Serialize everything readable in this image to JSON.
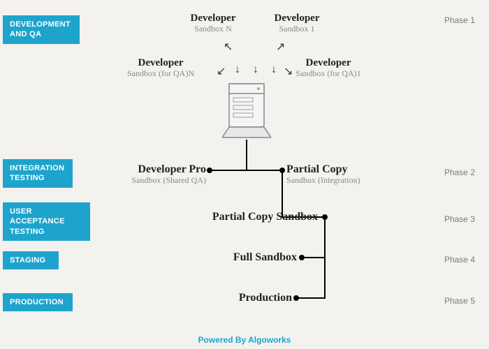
{
  "tags": {
    "dev_qa": "DEVELOPMENT\nAND QA",
    "integration": "INTEGRATION\nTESTING",
    "uat": "USER ACCEPTANCE\nTESTING",
    "staging": "STAGING",
    "production": "PRODUCTION"
  },
  "phases": {
    "p1": "Phase 1",
    "p2": "Phase 2",
    "p3": "Phase 3",
    "p4": "Phase 4",
    "p5": "Phase 5"
  },
  "top": {
    "devN_title": "Developer",
    "devN_sub": "Sandbox N",
    "dev1_title": "Developer",
    "dev1_sub": "Sandbox 1",
    "qaN_title": "Developer",
    "qaN_sub": "Sandbox (for QA)N",
    "qa1_title": "Developer",
    "qa1_sub": "Sandbox (for QA)1"
  },
  "phase2": {
    "left_title": "Developer Pro",
    "left_sub": "Sandbox (Shared QA)",
    "right_title": "Partial Copy",
    "right_sub": "Sandbox (Integration)"
  },
  "phase3": {
    "title": "Partial Copy Sandbox"
  },
  "phase4": {
    "title": "Full Sandbox"
  },
  "phase5": {
    "title": "Production"
  },
  "footer": "Powered By Algoworks"
}
